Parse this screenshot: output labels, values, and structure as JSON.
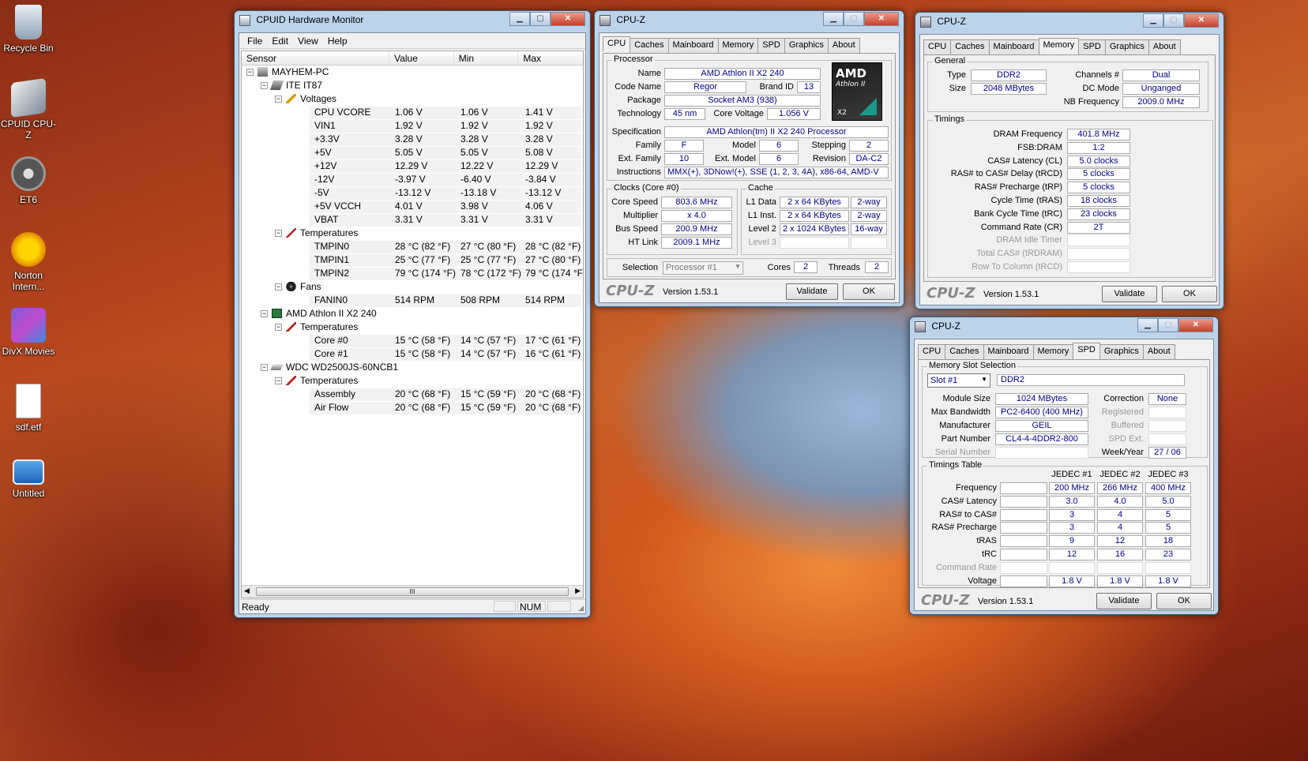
{
  "desktop": {
    "icons": [
      {
        "label": "Recycle Bin",
        "icon": "recycle-bin-icon"
      },
      {
        "label": "CPUID CPU-Z",
        "icon": "cpuz-shortcut-icon"
      },
      {
        "label": "ET6",
        "icon": "steering-wheel-icon"
      },
      {
        "label": "Norton Intern...",
        "icon": "norton-icon"
      },
      {
        "label": "DivX Movies",
        "icon": "divx-icon"
      },
      {
        "label": "sdf.etf",
        "icon": "file-icon"
      },
      {
        "label": "Untitled",
        "icon": "image-file-icon"
      }
    ]
  },
  "hwmon": {
    "title": "CPUID Hardware Monitor",
    "menu": [
      "File",
      "Edit",
      "View",
      "Help"
    ],
    "columns": [
      "Sensor",
      "Value",
      "Min",
      "Max"
    ],
    "rows": [
      {
        "level": 0,
        "label": "MAYHEM-PC",
        "icon": "computer-icon"
      },
      {
        "level": 1,
        "label": "ITE IT87",
        "icon": "chip-icon"
      },
      {
        "level": 2,
        "label": "Voltages",
        "icon": "voltage-icon"
      },
      {
        "level": 3,
        "label": "CPU VCORE",
        "value": "1.06 V",
        "min": "1.06 V",
        "max": "1.41 V"
      },
      {
        "level": 3,
        "label": "VIN1",
        "value": "1.92 V",
        "min": "1.92 V",
        "max": "1.92 V"
      },
      {
        "level": 3,
        "label": "+3.3V",
        "value": "3.28 V",
        "min": "3.28 V",
        "max": "3.28 V"
      },
      {
        "level": 3,
        "label": "+5V",
        "value": "5.05 V",
        "min": "5.05 V",
        "max": "5.08 V"
      },
      {
        "level": 3,
        "label": "+12V",
        "value": "12.29 V",
        "min": "12.22 V",
        "max": "12.29 V"
      },
      {
        "level": 3,
        "label": "-12V",
        "value": "-3.97 V",
        "min": "-6.40 V",
        "max": "-3.84 V"
      },
      {
        "level": 3,
        "label": "-5V",
        "value": "-13.12 V",
        "min": "-13.18 V",
        "max": "-13.12 V"
      },
      {
        "level": 3,
        "label": "+5V VCCH",
        "value": "4.01 V",
        "min": "3.98 V",
        "max": "4.06 V"
      },
      {
        "level": 3,
        "label": "VBAT",
        "value": "3.31 V",
        "min": "3.31 V",
        "max": "3.31 V"
      },
      {
        "level": 2,
        "label": "Temperatures",
        "icon": "thermometer-icon"
      },
      {
        "level": 3,
        "label": "TMPIN0",
        "value": "28 °C  (82 °F)",
        "min": "27 °C  (80 °F)",
        "max": "28 °C  (82 °F)"
      },
      {
        "level": 3,
        "label": "TMPIN1",
        "value": "25 °C  (77 °F)",
        "min": "25 °C  (77 °F)",
        "max": "27 °C  (80 °F)"
      },
      {
        "level": 3,
        "label": "TMPIN2",
        "value": "79 °C  (174 °F)",
        "min": "78 °C  (172 °F)",
        "max": "79 °C  (174 °F)"
      },
      {
        "level": 2,
        "label": "Fans",
        "icon": "fan-icon"
      },
      {
        "level": 3,
        "label": "FANIN0",
        "value": "514 RPM",
        "min": "508 RPM",
        "max": "514 RPM"
      },
      {
        "level": 1,
        "label": "AMD Athlon II X2 240",
        "icon": "cpu-chip-icon"
      },
      {
        "level": 2,
        "label": "Temperatures",
        "icon": "thermometer-icon"
      },
      {
        "level": 3,
        "label": "Core #0",
        "value": "15 °C  (58 °F)",
        "min": "14 °C  (57 °F)",
        "max": "17 °C  (61 °F)"
      },
      {
        "level": 3,
        "label": "Core #1",
        "value": "15 °C  (58 °F)",
        "min": "14 °C  (57 °F)",
        "max": "16 °C  (61 °F)"
      },
      {
        "level": 1,
        "label": "WDC WD2500JS-60NCB1",
        "icon": "hard-drive-icon"
      },
      {
        "level": 2,
        "label": "Temperatures",
        "icon": "thermometer-icon"
      },
      {
        "level": 3,
        "label": "Assembly",
        "value": "20 °C  (68 °F)",
        "min": "15 °C  (59 °F)",
        "max": "20 °C  (68 °F)"
      },
      {
        "level": 3,
        "label": "Air Flow",
        "value": "20 °C  (68 °F)",
        "min": "15 °C  (59 °F)",
        "max": "20 °C  (68 °F)"
      }
    ],
    "status": "Ready",
    "num": "NUM",
    "hscroll_thumb": "III"
  },
  "cpuz_common": {
    "title": "CPU-Z",
    "tabs": [
      "CPU",
      "Caches",
      "Mainboard",
      "Memory",
      "SPD",
      "Graphics",
      "About"
    ],
    "logo": "CPU-Z",
    "version": "Version 1.53.1",
    "validate": "Validate",
    "ok": "OK"
  },
  "cpu": {
    "processor_group": "Processor",
    "name_label": "Name",
    "name": "AMD Athlon II X2 240",
    "codename_label": "Code Name",
    "codename": "Regor",
    "brandid_label": "Brand ID",
    "brandid": "13",
    "package_label": "Package",
    "package": "Socket AM3 (938)",
    "tech_label": "Technology",
    "tech": "45 nm",
    "corevolt_label": "Core Voltage",
    "corevolt": "1.056 V",
    "spec_label": "Specification",
    "spec": "AMD Athlon(tm) II X2 240 Processor",
    "family_label": "Family",
    "family": "F",
    "model_label": "Model",
    "model": "6",
    "stepping_label": "Stepping",
    "stepping": "2",
    "extfamily_label": "Ext. Family",
    "extfamily": "10",
    "extmodel_label": "Ext. Model",
    "extmodel": "6",
    "revision_label": "Revision",
    "revision": "DA-C2",
    "instr_label": "Instructions",
    "instr": "MMX(+), 3DNow!(+), SSE (1, 2, 3, 4A), x86-64, AMD-V",
    "clocks_group": "Clocks (Core #0)",
    "corespeed_label": "Core Speed",
    "corespeed": "803.6 MHz",
    "mult_label": "Multiplier",
    "mult": "x 4.0",
    "bus_label": "Bus Speed",
    "bus": "200.9 MHz",
    "ht_label": "HT Link",
    "ht": "2009.1 MHz",
    "cache_group": "Cache",
    "l1d_label": "L1 Data",
    "l1d": "2 x 64 KBytes",
    "l1d_way": "2-way",
    "l1i_label": "L1 Inst.",
    "l1i": "2 x 64 KBytes",
    "l1i_way": "2-way",
    "l2_label": "Level 2",
    "l2": "2 x 1024 KBytes",
    "l2_way": "16-way",
    "l3_label": "Level 3",
    "selection_label": "Selection",
    "selection": "Processor #1",
    "cores_label": "Cores",
    "cores": "2",
    "threads_label": "Threads",
    "threads": "2",
    "badge_brand": "AMD",
    "badge_model": "Athlon II",
    "badge_variant": "X2"
  },
  "memory": {
    "general_group": "General",
    "type_label": "Type",
    "type": "DDR2",
    "size_label": "Size",
    "size": "2048 MBytes",
    "channels_label": "Channels #",
    "channels": "Dual",
    "dcmode_label": "DC Mode",
    "dcmode": "Unganged",
    "nbfreq_label": "NB Frequency",
    "nbfreq": "2009.0 MHz",
    "timings_group": "Timings",
    "rows": [
      {
        "label": "DRAM Frequency",
        "value": "401.8 MHz"
      },
      {
        "label": "FSB:DRAM",
        "value": "1:2"
      },
      {
        "label": "CAS# Latency (CL)",
        "value": "5.0 clocks"
      },
      {
        "label": "RAS# to CAS# Delay (tRCD)",
        "value": "5 clocks"
      },
      {
        "label": "RAS# Precharge (tRP)",
        "value": "5 clocks"
      },
      {
        "label": "Cycle Time (tRAS)",
        "value": "18 clocks"
      },
      {
        "label": "Bank Cycle Time (tRC)",
        "value": "23 clocks"
      },
      {
        "label": "Command Rate (CR)",
        "value": "2T"
      },
      {
        "label": "DRAM Idle Timer",
        "value": "",
        "dim": true
      },
      {
        "label": "Total CAS# (tRDRAM)",
        "value": "",
        "dim": true
      },
      {
        "label": "Row To Column (tRCD)",
        "value": "",
        "dim": true
      }
    ]
  },
  "spd": {
    "slot_group": "Memory Slot Selection",
    "slot": "Slot #1",
    "slot_type": "DDR2",
    "modsize_label": "Module Size",
    "modsize": "1024 MBytes",
    "maxbw_label": "Max Bandwidth",
    "maxbw": "PC2-6400 (400 MHz)",
    "manuf_label": "Manufacturer",
    "manuf": "GEIL",
    "part_label": "Part Number",
    "part": "CL4-4-4DDR2-800",
    "serial_label": "Serial Number",
    "correction_label": "Correction",
    "correction": "None",
    "registered_label": "Registered",
    "buffered_label": "Buffered",
    "spdext_label": "SPD Ext.",
    "week_label": "Week/Year",
    "week": "27 / 06",
    "timings_group": "Timings Table",
    "jedec_headers": [
      "JEDEC #1",
      "JEDEC #2",
      "JEDEC #3"
    ],
    "rows": [
      {
        "label": "Frequency",
        "values": [
          "200 MHz",
          "266 MHz",
          "400 MHz"
        ]
      },
      {
        "label": "CAS# Latency",
        "values": [
          "3.0",
          "4.0",
          "5.0"
        ]
      },
      {
        "label": "RAS# to CAS#",
        "values": [
          "3",
          "4",
          "5"
        ]
      },
      {
        "label": "RAS# Precharge",
        "values": [
          "3",
          "4",
          "5"
        ]
      },
      {
        "label": "tRAS",
        "values": [
          "9",
          "12",
          "18"
        ]
      },
      {
        "label": "tRC",
        "values": [
          "12",
          "16",
          "23"
        ]
      },
      {
        "label": "Command Rate",
        "values": [
          "",
          "",
          ""
        ],
        "dim": true
      },
      {
        "label": "Voltage",
        "values": [
          "1.8 V",
          "1.8 V",
          "1.8 V"
        ]
      }
    ]
  }
}
